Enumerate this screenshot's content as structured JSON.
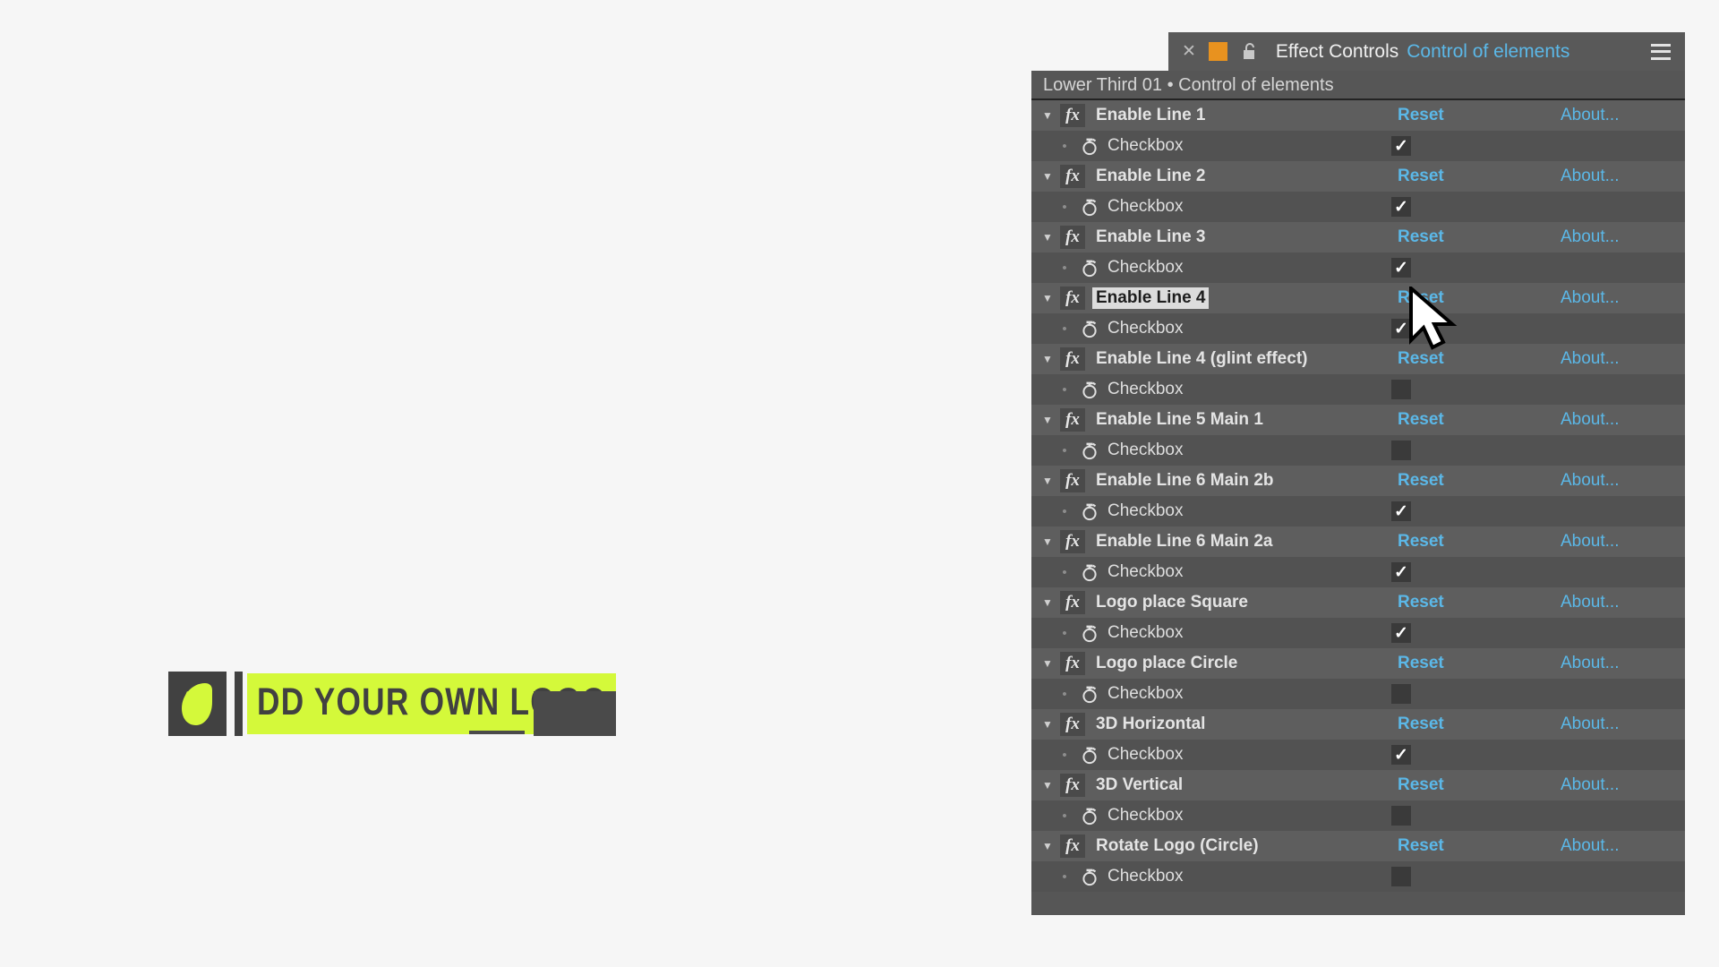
{
  "panel": {
    "tab": {
      "close_icon": "close-icon",
      "swatch_color": "#e8921f",
      "lock_icon": "lock-open-icon",
      "title": "Effect Controls",
      "subtitle": "Control of elements",
      "menu_icon": "hamburger-menu-icon"
    },
    "breadcrumb": "Lower Third 01 • Control of elements",
    "column_labels": {
      "reset": "Reset",
      "about": "About..."
    },
    "param_label": "Checkbox",
    "disclosure_glyph": "▼",
    "fx_glyph": "fx",
    "check_glyph": "✓",
    "effects": [
      {
        "title": "Enable Line 1",
        "reset": "Reset",
        "about": "About...",
        "checked": true,
        "selected": false
      },
      {
        "title": "Enable Line 2",
        "reset": "Reset",
        "about": "About...",
        "checked": true,
        "selected": false
      },
      {
        "title": "Enable Line 3",
        "reset": "Reset",
        "about": "About...",
        "checked": true,
        "selected": false
      },
      {
        "title": "Enable Line 4",
        "reset": "Reset",
        "about": "About...",
        "checked": true,
        "selected": true
      },
      {
        "title": "Enable Line 4 (glint effect)",
        "reset": "Reset",
        "about": "About...",
        "checked": false,
        "selected": false
      },
      {
        "title": "Enable Line 5 Main 1",
        "reset": "Reset",
        "about": "About...",
        "checked": false,
        "selected": false
      },
      {
        "title": "Enable Line 6 Main 2b",
        "reset": "Reset",
        "about": "About...",
        "checked": true,
        "selected": false
      },
      {
        "title": "Enable Line 6 Main 2a",
        "reset": "Reset",
        "about": "About...",
        "checked": true,
        "selected": false
      },
      {
        "title": "Logo place Square",
        "reset": "Reset",
        "about": "About...",
        "checked": true,
        "selected": false
      },
      {
        "title": "Logo place Circle",
        "reset": "Reset",
        "about": "About...",
        "checked": false,
        "selected": false
      },
      {
        "title": "3D Horizontal",
        "reset": "Reset",
        "about": "About...",
        "checked": true,
        "selected": false
      },
      {
        "title": "3D Vertical",
        "reset": "Reset",
        "about": "About...",
        "checked": false,
        "selected": false
      },
      {
        "title": "Rotate Logo (Circle)",
        "reset": "Reset",
        "about": "About...",
        "checked": false,
        "selected": false
      }
    ]
  },
  "lower_third": {
    "text": "DD YOUR OWN LOGO",
    "accent_color": "#d4f93a",
    "dark_color": "#414141",
    "logo_icon": "leaf-logo-icon"
  },
  "cursor": {
    "icon": "mouse-pointer-icon"
  }
}
